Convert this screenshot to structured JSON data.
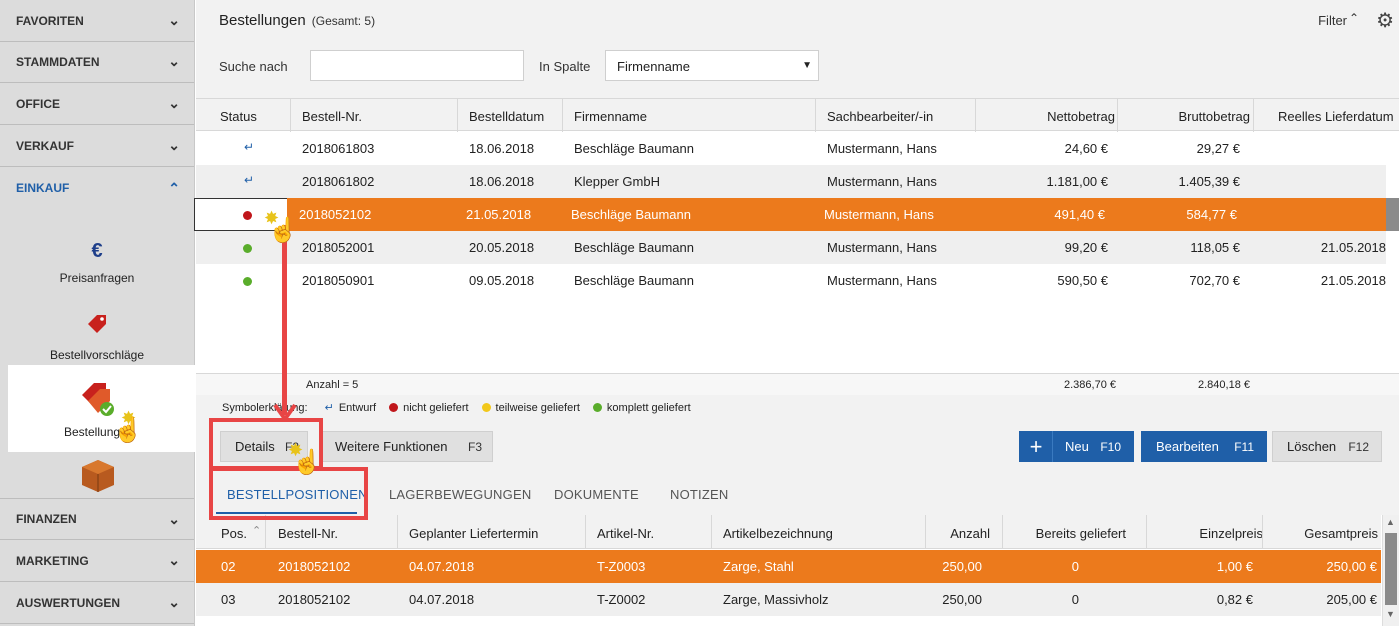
{
  "sidebar": {
    "items": [
      {
        "label": "FAVORITEN"
      },
      {
        "label": "STAMMDATEN"
      },
      {
        "label": "OFFICE"
      },
      {
        "label": "VERKAUF"
      },
      {
        "label": "EINKAUF"
      },
      {
        "label": "FINANZEN"
      },
      {
        "label": "MARKETING"
      },
      {
        "label": "AUSWERTUNGEN"
      }
    ],
    "sub_items": [
      {
        "label": "Preisanfragen",
        "icon": "euro-icon"
      },
      {
        "label": "Bestellvorschläge",
        "icon": "tag-icon"
      },
      {
        "label": "Bestellungen",
        "icon": "tag-check-icon"
      },
      {
        "label": "",
        "icon": "box-icon"
      }
    ]
  },
  "header": {
    "title": "Bestellungen",
    "count": "(Gesamt: 5)",
    "filter_label": "Filter"
  },
  "search": {
    "label": "Suche nach",
    "value": "",
    "column_label": "In Spalte",
    "column_value": "Firmenname"
  },
  "orders": {
    "columns": [
      "Status",
      "Bestell-Nr.",
      "Bestelldatum",
      "Firmenname",
      "Sachbearbeiter/-in",
      "Nettobetrag",
      "Bruttobetrag",
      "Reelles Lieferdatum"
    ],
    "rows": [
      {
        "status": "entwurf",
        "nr": "2018061803",
        "datum": "18.06.2018",
        "firma": "Beschläge Baumann",
        "bearbeiter": "Mustermann, Hans",
        "netto": "24,60 €",
        "brutto": "29,27 €",
        "liefer": ""
      },
      {
        "status": "entwurf",
        "nr": "2018061802",
        "datum": "18.06.2018",
        "firma": "Klepper GmbH",
        "bearbeiter": "Mustermann, Hans",
        "netto": "1.181,00 €",
        "brutto": "1.405,39 €",
        "liefer": ""
      },
      {
        "status": "nicht",
        "nr": "2018052102",
        "datum": "21.05.2018",
        "firma": "Beschläge Baumann",
        "bearbeiter": "Mustermann, Hans",
        "netto": "491,40 €",
        "brutto": "584,77 €",
        "liefer": ""
      },
      {
        "status": "komplett",
        "nr": "2018052001",
        "datum": "20.05.2018",
        "firma": "Beschläge Baumann",
        "bearbeiter": "Mustermann, Hans",
        "netto": "99,20 €",
        "brutto": "118,05 €",
        "liefer": "21.05.2018"
      },
      {
        "status": "komplett",
        "nr": "2018050901",
        "datum": "09.05.2018",
        "firma": "Beschläge Baumann",
        "bearbeiter": "Mustermann, Hans",
        "netto": "590,50 €",
        "brutto": "702,70 €",
        "liefer": "21.05.2018"
      }
    ],
    "summary": {
      "count": "Anzahl = 5",
      "netto": "2.386,70 €",
      "brutto": "2.840,18 €"
    }
  },
  "legend": {
    "label": "Symbolerklärung:",
    "entwurf": "Entwurf",
    "nicht": "nicht geliefert",
    "teilweise": "teilweise geliefert",
    "komplett": "komplett geliefert"
  },
  "buttons": {
    "details": "Details",
    "details_key": "F2",
    "weitere": "Weitere Funktionen",
    "weitere_key": "F3",
    "neu": "Neu",
    "neu_key": "F10",
    "bearbeiten": "Bearbeiten",
    "bearbeiten_key": "F11",
    "loeschen": "Löschen",
    "loeschen_key": "F12"
  },
  "tabs": [
    "BESTELLPOSITIONEN",
    "LAGERBEWEGUNGEN",
    "DOKUMENTE",
    "NOTIZEN"
  ],
  "positions": {
    "columns": [
      "Pos.",
      "Bestell-Nr.",
      "Geplanter Liefertermin",
      "Artikel-Nr.",
      "Artikelbezeichnung",
      "Anzahl",
      "Bereits geliefert",
      "Einzelpreis",
      "Gesamtpreis"
    ],
    "rows": [
      {
        "pos": "02",
        "nr": "2018052102",
        "termin": "04.07.2018",
        "artikel": "T-Z0003",
        "bezeichnung": "Zarge, Stahl",
        "anzahl": "250,00",
        "geliefert": "0",
        "einzel": "1,00 €",
        "gesamt": "250,00 €"
      },
      {
        "pos": "03",
        "nr": "2018052102",
        "termin": "04.07.2018",
        "artikel": "T-Z0002",
        "bezeichnung": "Zarge, Massivholz",
        "anzahl": "250,00",
        "geliefert": "0",
        "einzel": "0,82 €",
        "gesamt": "205,00 €"
      }
    ]
  },
  "colors": {
    "accent": "#1f5fa8",
    "selected_row": "#ec7a1c",
    "annotation": "#e84545",
    "red_dot": "#c0161b",
    "yellow_dot": "#f2c81b",
    "green_dot": "#5aad2b"
  }
}
